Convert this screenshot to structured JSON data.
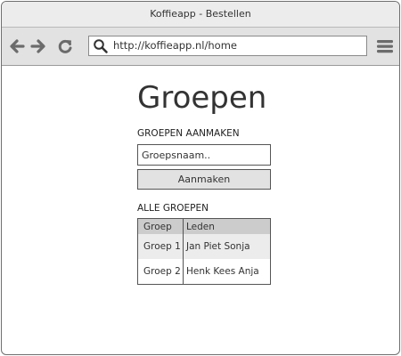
{
  "window": {
    "title": "Koffieapp - Bestellen"
  },
  "toolbar": {
    "back_icon": "arrow-left-icon",
    "forward_icon": "arrow-right-icon",
    "reload_icon": "reload-icon",
    "search_icon": "search-icon",
    "menu_icon": "hamburger-menu-icon",
    "url": "http://koffieapp.nl/home"
  },
  "page": {
    "title": "Groepen",
    "create_section": {
      "label": "GROEPEN AANMAKEN",
      "input_placeholder": "Groepsnaam..",
      "button_label": "Aanmaken"
    },
    "all_section": {
      "label": "ALLE GROEPEN",
      "columns": [
        "Groep",
        "Leden"
      ],
      "rows": [
        [
          "Groep 1",
          "Jan Piet Sonja"
        ],
        [
          "Groep 2",
          "Henk Kees Anja"
        ]
      ]
    }
  },
  "colors": {
    "chrome": "#e2e2e2",
    "icon": "#6b6b6b",
    "table_header": "#cccccc",
    "row_alt": "#ececec"
  }
}
